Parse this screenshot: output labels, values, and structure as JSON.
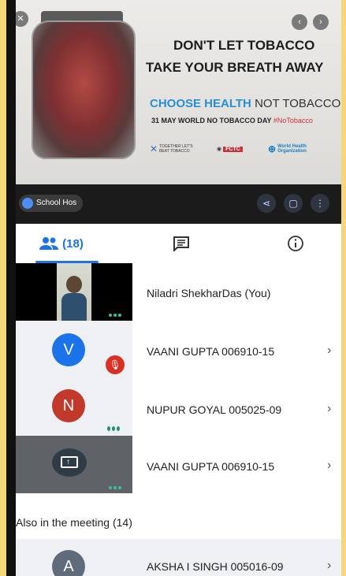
{
  "video": {
    "poster": {
      "headline1": "DON'T LET TOBACCO",
      "headline2": "TAKE YOUR BREATH AWAY",
      "choose_health": "CHOOSE HEALTH",
      "not_tobacco": "NOT TOBACCO",
      "date_line": "31 MAY WORLD NO TOBACCO DAY",
      "hashtag": "#NoTobacco",
      "logo_together": "TOGETHER LET'S BEAT TOBACCO",
      "logo_fctc": "FCTC",
      "logo_who": "World Health Organization"
    },
    "presenter_chip": "School Hos",
    "colors": {
      "accent_blue": "#1a73e8",
      "frame_yellow": "#f5d77a"
    }
  },
  "tabs": {
    "people_count": "(18)",
    "icons": [
      "people-icon",
      "chat-icon",
      "info-icon"
    ]
  },
  "participants": [
    {
      "name": "Niladri ShekharDas (You)",
      "tile": "camera"
    },
    {
      "name": "VAANI GUPTA 006910-15",
      "initial": "V",
      "muted": true
    },
    {
      "name": "NUPUR GOYAL 005025-09",
      "initial": "N"
    },
    {
      "name": "VAANI GUPTA 006910-15",
      "tile": "presentation"
    }
  ],
  "also_in_meeting": {
    "label": "Also in the meeting (14)",
    "first": {
      "initial": "A",
      "name": "AKSHA I SINGH 005016-09"
    }
  }
}
